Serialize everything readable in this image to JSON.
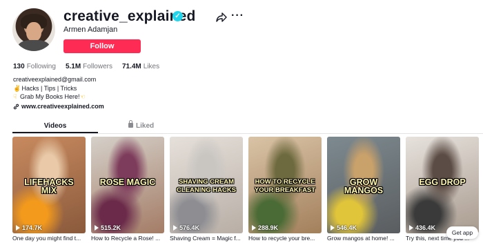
{
  "profile": {
    "username": "creative_explained",
    "nickname": "Armen Adamjan",
    "follow_label": "Follow",
    "verified_symbol": "✓"
  },
  "header_actions": {
    "share_icon": "share-arrow-icon",
    "more_label": "···"
  },
  "stats": {
    "following_count": "130",
    "following_label": "Following",
    "followers_count": "5.1M",
    "followers_label": "Followers",
    "likes_count": "71.4M",
    "likes_label": "Likes"
  },
  "bio": {
    "email": "creativeexplained@gmail.com",
    "line2": "Hacks | Tips | Tricks",
    "line3": "Grab My Books Here!",
    "line2_emoji": "✌",
    "line3_emoji_left": "☟",
    "line3_emoji_right": "☜",
    "link": "www.creativeexplained.com"
  },
  "tabs": {
    "videos": "Videos",
    "liked": "Liked"
  },
  "videos": [
    {
      "overlay": "LIFEHACKS MIX",
      "views": "174.7K",
      "caption": "One day you might find t...",
      "colors": [
        "#c88a5f",
        "#8a5a3c",
        "#e9c9a8"
      ],
      "accent": "#f39a1c"
    },
    {
      "overlay": "ROSE MAGIC",
      "views": "515.2K",
      "caption": "How to Recycle a Rose! ...",
      "colors": [
        "#d5d0c9",
        "#a47c66",
        "#7e3c5c"
      ],
      "accent": "#6b2a4a"
    },
    {
      "overlay": "SHAVING CREAM CLEANING HACKS",
      "views": "576.4K",
      "caption": "Shaving Cream = Magic f...",
      "colors": [
        "#e6e0da",
        "#b8aea6",
        "#c9c6c2"
      ],
      "accent": "#8d8d92"
    },
    {
      "overlay": "HOW TO RECYCLE YOUR BREAKFAST",
      "views": "288.9K",
      "caption": "How to recycle your bre...",
      "colors": [
        "#d9c3a6",
        "#a3805c",
        "#6e6a3f"
      ],
      "accent": "#4a6b35"
    },
    {
      "overlay": "GROW MANGOS",
      "views": "546.4K",
      "caption": "Grow mangos at home! ...",
      "colors": [
        "#7d8a90",
        "#5a5d60",
        "#c9a16a"
      ],
      "accent": "#e0c43a"
    },
    {
      "overlay": "EGG DROP",
      "views": "436.4K",
      "caption": "Try this, next time you ...",
      "colors": [
        "#e7e2dd",
        "#a89a8e",
        "#5b4c45"
      ],
      "accent": "#3a3a3a"
    }
  ],
  "get_app_label": "Get app"
}
